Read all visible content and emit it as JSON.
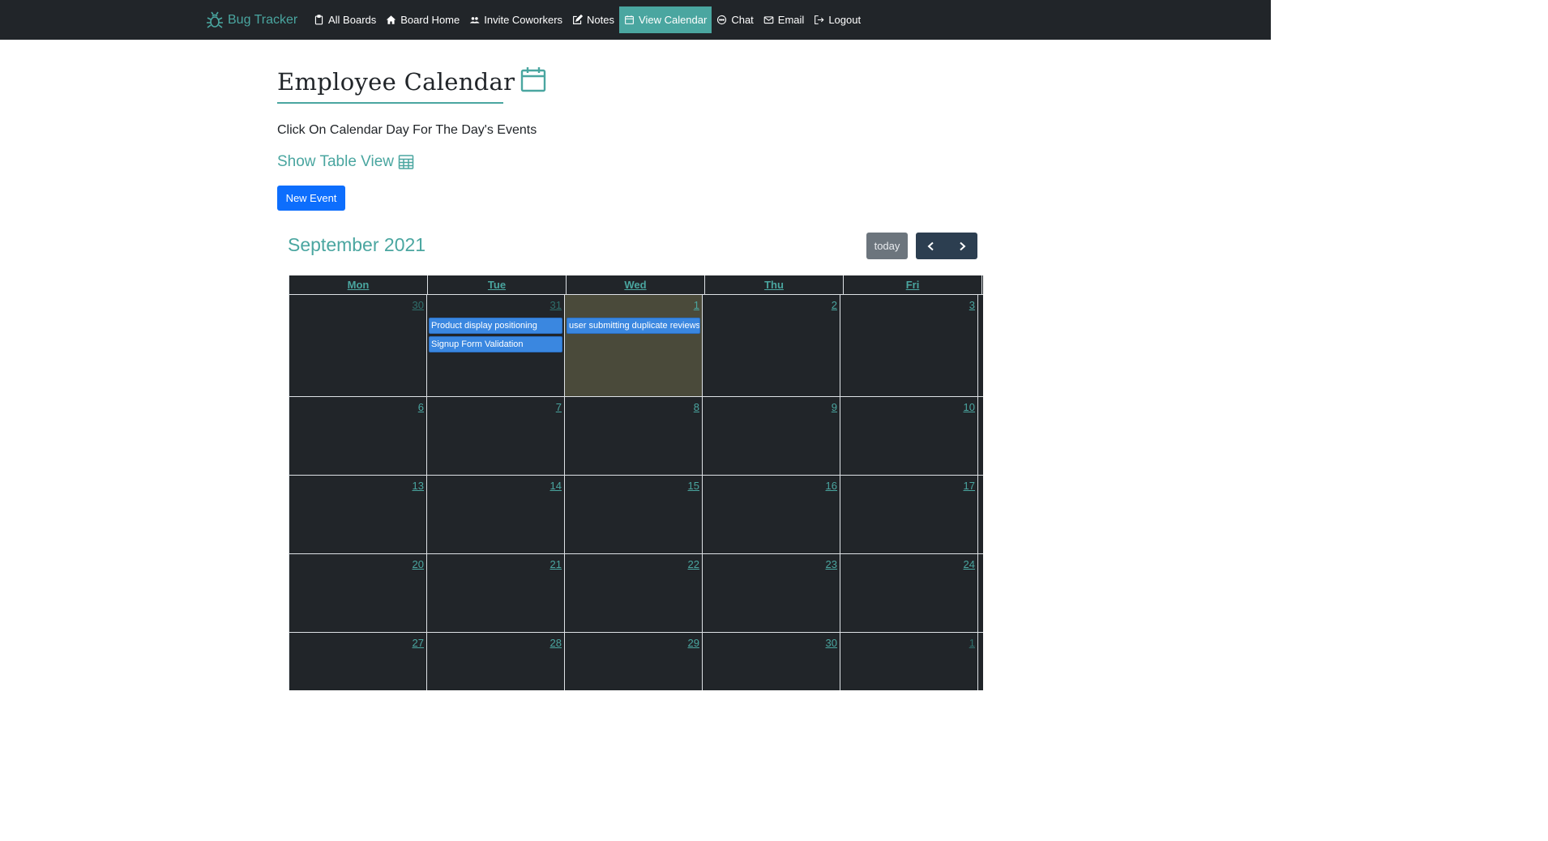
{
  "navbar": {
    "brand": "Bug Tracker",
    "items": [
      {
        "label": "All Boards",
        "icon": "clipboard-icon"
      },
      {
        "label": "Board Home",
        "icon": "home-icon"
      },
      {
        "label": "Invite Coworkers",
        "icon": "people-icon"
      },
      {
        "label": "Notes",
        "icon": "pencil-square-icon"
      },
      {
        "label": "View Calendar",
        "icon": "calendar-icon",
        "active": true
      },
      {
        "label": "Chat",
        "icon": "chat-icon"
      },
      {
        "label": "Email",
        "icon": "envelope-icon"
      },
      {
        "label": "Logout",
        "icon": "logout-icon"
      }
    ]
  },
  "page": {
    "title": "Employee Calendar",
    "instruction": "Click On Calendar Day For The Day's Events",
    "table_toggle": "Show Table View",
    "new_event_label": "New Event"
  },
  "calendar": {
    "month_title": "September 2021",
    "today_label": "today",
    "weekdays": [
      "Mon",
      "Tue",
      "Wed",
      "Thu",
      "Fri"
    ],
    "weeks": [
      [
        {
          "num": "30",
          "other": true,
          "events": []
        },
        {
          "num": "31",
          "other": true,
          "events": [
            "Product display positioning",
            "Signup Form Validation"
          ]
        },
        {
          "num": "1",
          "today": true,
          "events": [
            "user submitting duplicate reviews"
          ]
        },
        {
          "num": "2",
          "events": []
        },
        {
          "num": "3",
          "events": []
        }
      ],
      [
        {
          "num": "6",
          "events": []
        },
        {
          "num": "7",
          "events": []
        },
        {
          "num": "8",
          "events": []
        },
        {
          "num": "9",
          "events": []
        },
        {
          "num": "10",
          "events": []
        }
      ],
      [
        {
          "num": "13",
          "events": []
        },
        {
          "num": "14",
          "events": []
        },
        {
          "num": "15",
          "events": []
        },
        {
          "num": "16",
          "events": []
        },
        {
          "num": "17",
          "events": []
        }
      ],
      [
        {
          "num": "20",
          "events": []
        },
        {
          "num": "21",
          "events": []
        },
        {
          "num": "22",
          "events": []
        },
        {
          "num": "23",
          "events": []
        },
        {
          "num": "24",
          "events": []
        }
      ],
      [
        {
          "num": "27",
          "events": []
        },
        {
          "num": "28",
          "events": []
        },
        {
          "num": "29",
          "events": []
        },
        {
          "num": "30",
          "events": []
        },
        {
          "num": "1",
          "other": true,
          "events": []
        }
      ]
    ]
  },
  "colors": {
    "accent": "#4aa6a0",
    "navbar_bg": "#212529",
    "primary_button": "#0d6efd",
    "event_bg": "#3a87e0",
    "today_bg": "#4a4a3a"
  }
}
